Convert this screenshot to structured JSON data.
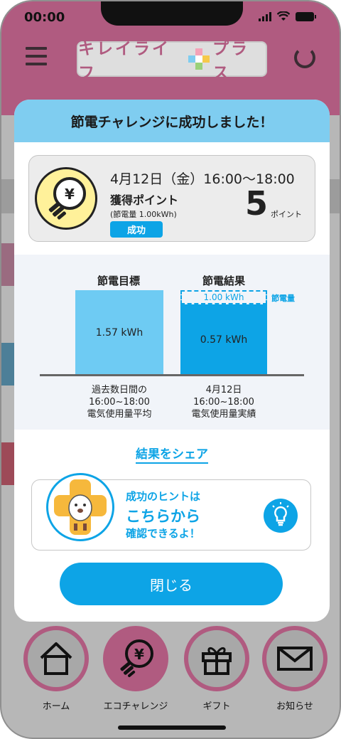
{
  "status_bar": {
    "time": "00:00"
  },
  "header": {
    "logo_text_left": "キレイライフ",
    "logo_text_right": "プラス"
  },
  "modal": {
    "title": "節電チャレンジに成功しました！",
    "summary": {
      "date_time": "4月12日（金）16:00〜18:00",
      "points_label": "獲得ポイント",
      "saving_note": "(節電量 1.00kWh)",
      "status_badge": "成功",
      "points_value": "5",
      "points_unit": "ポイント"
    },
    "comparison": {
      "target_heading": "節電目標",
      "result_heading": "節電結果",
      "target_value_label": "1.57 kWh",
      "result_value_label": "0.57 kWh",
      "saved_value_label": "1.00 kWh",
      "saved_tag": "節電量",
      "target_caption_1": "過去数日間の",
      "target_caption_2": "16:00~18:00",
      "target_caption_3": "電気使用量平均",
      "result_caption_1": "4月12日",
      "result_caption_2": "16:00~18:00",
      "result_caption_3": "電気使用量実績"
    },
    "share_link": "結果をシェア",
    "hint": {
      "line1": "成功のヒントは",
      "line2": "こちらから",
      "line3": "確認できるよ！"
    },
    "close_label": "閉じる"
  },
  "nav": {
    "home": "ホーム",
    "eco_challenge": "エコチャレンジ",
    "gift": "ギフト",
    "notice": "お知らせ"
  },
  "colors": {
    "brand_pink": "#b05b80",
    "accent_blue": "#0da4e6",
    "header_blue": "#7fcdf0",
    "target_bar": "#6ecbf3"
  }
}
